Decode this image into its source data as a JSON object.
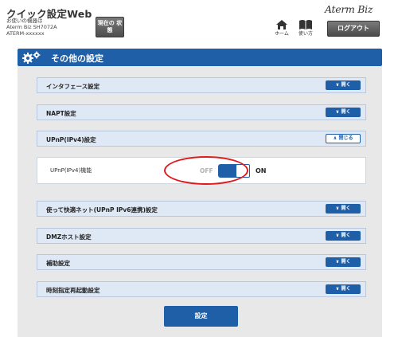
{
  "header": {
    "app_title": "クイック設定Web",
    "device_lines": [
      "お使いの機器は",
      "Aterm Biz SH7072A",
      "ATERM-xxxxxx"
    ],
    "status_button": "現在の 状態",
    "brand": "Aterm Biz",
    "nav": [
      {
        "label": "ホーム",
        "icon": "home-icon"
      },
      {
        "label": "使い方",
        "icon": "book-icon"
      }
    ],
    "logout_label": "ログアウト"
  },
  "section": {
    "title": "その他の設定",
    "icon": "gear-icon",
    "color": "#1f5fa8"
  },
  "accordions": [
    {
      "label": "インタフェース設定",
      "button": "開く",
      "state": "closed"
    },
    {
      "label": "NAPT設定",
      "button": "開く",
      "state": "closed"
    },
    {
      "label": "UPnP(IPv4)設定",
      "button": "閉じる",
      "state": "open"
    },
    {
      "label": "使って快適ネット(UPnP IPv6連携)設定",
      "button": "開く",
      "state": "closed"
    },
    {
      "label": "DMZホスト設定",
      "button": "開く",
      "state": "closed"
    },
    {
      "label": "補助設定",
      "button": "開く",
      "state": "closed"
    },
    {
      "label": "時刻指定再起動設定",
      "button": "開く",
      "state": "closed"
    }
  ],
  "upnp": {
    "field_label": "UPnP(IPv4)機能",
    "toggle_off_label": "OFF",
    "toggle_on_label": "ON",
    "toggle_state": "ON",
    "highlight_color": "#e0191b"
  },
  "submit_label": "設定"
}
